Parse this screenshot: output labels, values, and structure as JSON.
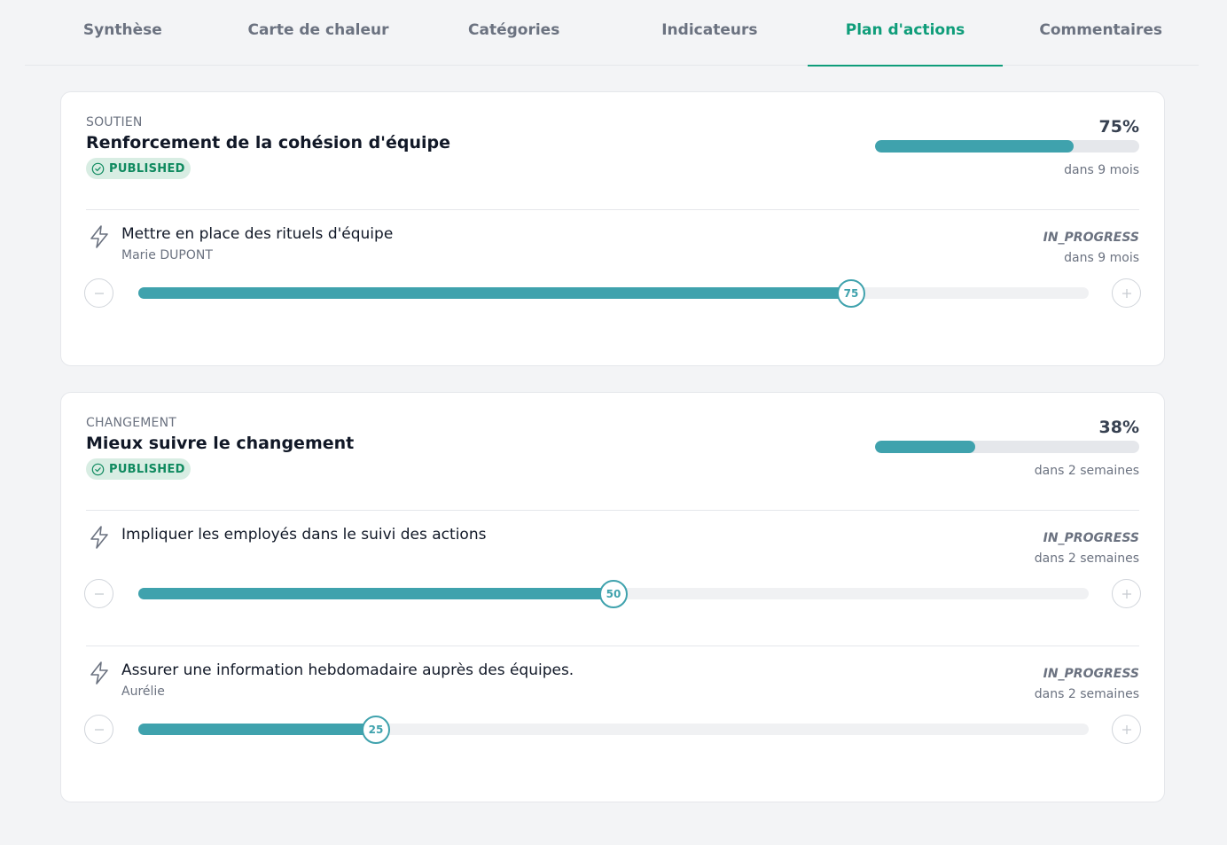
{
  "tabs": [
    {
      "label": "Synthèse",
      "active": false
    },
    {
      "label": "Carte de chaleur",
      "active": false
    },
    {
      "label": "Catégories",
      "active": false
    },
    {
      "label": "Indicateurs",
      "active": false
    },
    {
      "label": "Plan d'actions",
      "active": true
    },
    {
      "label": "Commentaires",
      "active": false
    }
  ],
  "colors": {
    "accent": "#3fa2ad",
    "active_tab": "#0f9d7a",
    "badge_bg": "#d8ede3",
    "badge_text": "#0f8a5f"
  },
  "cards": [
    {
      "category": "SOUTIEN",
      "title": "Renforcement de la cohésion d'équipe",
      "badge": "PUBLISHED",
      "progress_label": "75%",
      "progress": 0.75,
      "due": "dans 9 mois",
      "actions": [
        {
          "icon": "bolt-icon",
          "title": "Mettre en place des rituels d'équipe",
          "owner": "Marie DUPONT",
          "status": "IN_PROGRESS",
          "due": "dans 9 mois",
          "value": "75"
        }
      ]
    },
    {
      "category": "CHANGEMENT",
      "title": "Mieux suivre le changement",
      "badge": "PUBLISHED",
      "progress_label": "38%",
      "progress": 0.38,
      "due": "dans 2 semaines",
      "actions": [
        {
          "icon": "bolt-icon",
          "title": "Impliquer les employés dans le suivi des actions",
          "owner": "",
          "status": "IN_PROGRESS",
          "due": "dans 2 semaines",
          "value": "50"
        },
        {
          "icon": "bolt-icon",
          "title": "Assurer une information hebdomadaire auprès des équipes.",
          "owner": "Aurélie",
          "status": "IN_PROGRESS",
          "due": "dans 2 semaines",
          "value": "25"
        }
      ]
    }
  ]
}
